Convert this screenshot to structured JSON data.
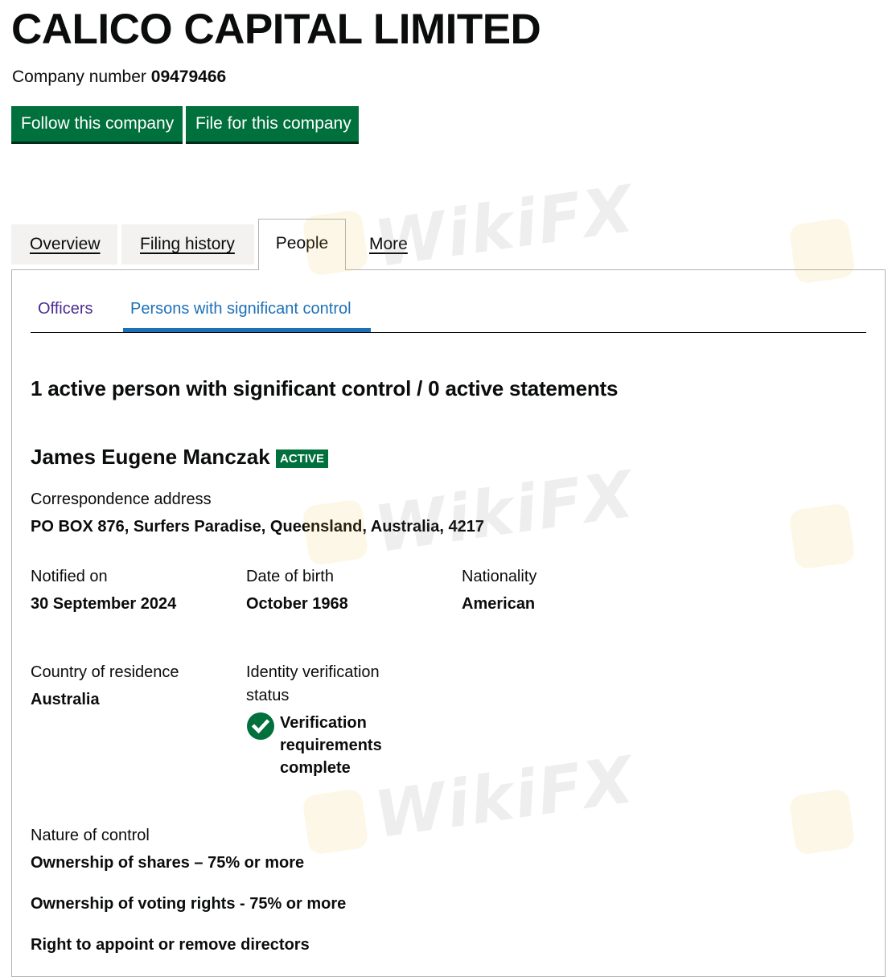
{
  "company": {
    "name": "CALICO CAPITAL LIMITED",
    "number_label": "Company number",
    "number": "09479466"
  },
  "actions": {
    "follow_label": "Follow this company",
    "file_label": "File for this company"
  },
  "tabs": [
    {
      "label": "Overview"
    },
    {
      "label": "Filing history"
    },
    {
      "label": "People",
      "active": true
    },
    {
      "label": "More"
    }
  ],
  "subtabs": [
    {
      "label": "Officers"
    },
    {
      "label": "Persons with significant control",
      "active": true
    }
  ],
  "summary_heading": "1 active person with significant control / 0 active statements",
  "person": {
    "name": "James Eugene Manczak",
    "status": "ACTIVE",
    "correspondence_label": "Correspondence address",
    "correspondence_value": "PO BOX 876, Surfers Paradise, Queensland, Australia, 4217",
    "notified_label": "Notified on",
    "notified_value": "30 September 2024",
    "dob_label": "Date of birth",
    "dob_value": "October 1968",
    "nationality_label": "Nationality",
    "nationality_value": "American",
    "residence_label": "Country of residence",
    "residence_value": "Australia",
    "identity_label_line1": "Identity verification",
    "identity_label_line2": "status",
    "identity_value_line1": "Verification",
    "identity_value_line2": "requirements",
    "identity_value_line3": "complete",
    "nature_label": "Nature of control",
    "nature_items": [
      "Ownership of shares – 75% or more",
      "Ownership of voting rights - 75% or more",
      "Right to appoint or remove directors"
    ]
  },
  "watermarks": [
    "WikiFX",
    "WikiFX",
    "WikiFX"
  ],
  "icons": {
    "verification": "check-circle-icon",
    "watermark_logo": "wikifx-logo-icon"
  },
  "colors": {
    "primary_green": "#00703c",
    "link_blue": "#1d70b8",
    "visited_purple": "#4c2c92",
    "text": "#0b0c0c"
  }
}
